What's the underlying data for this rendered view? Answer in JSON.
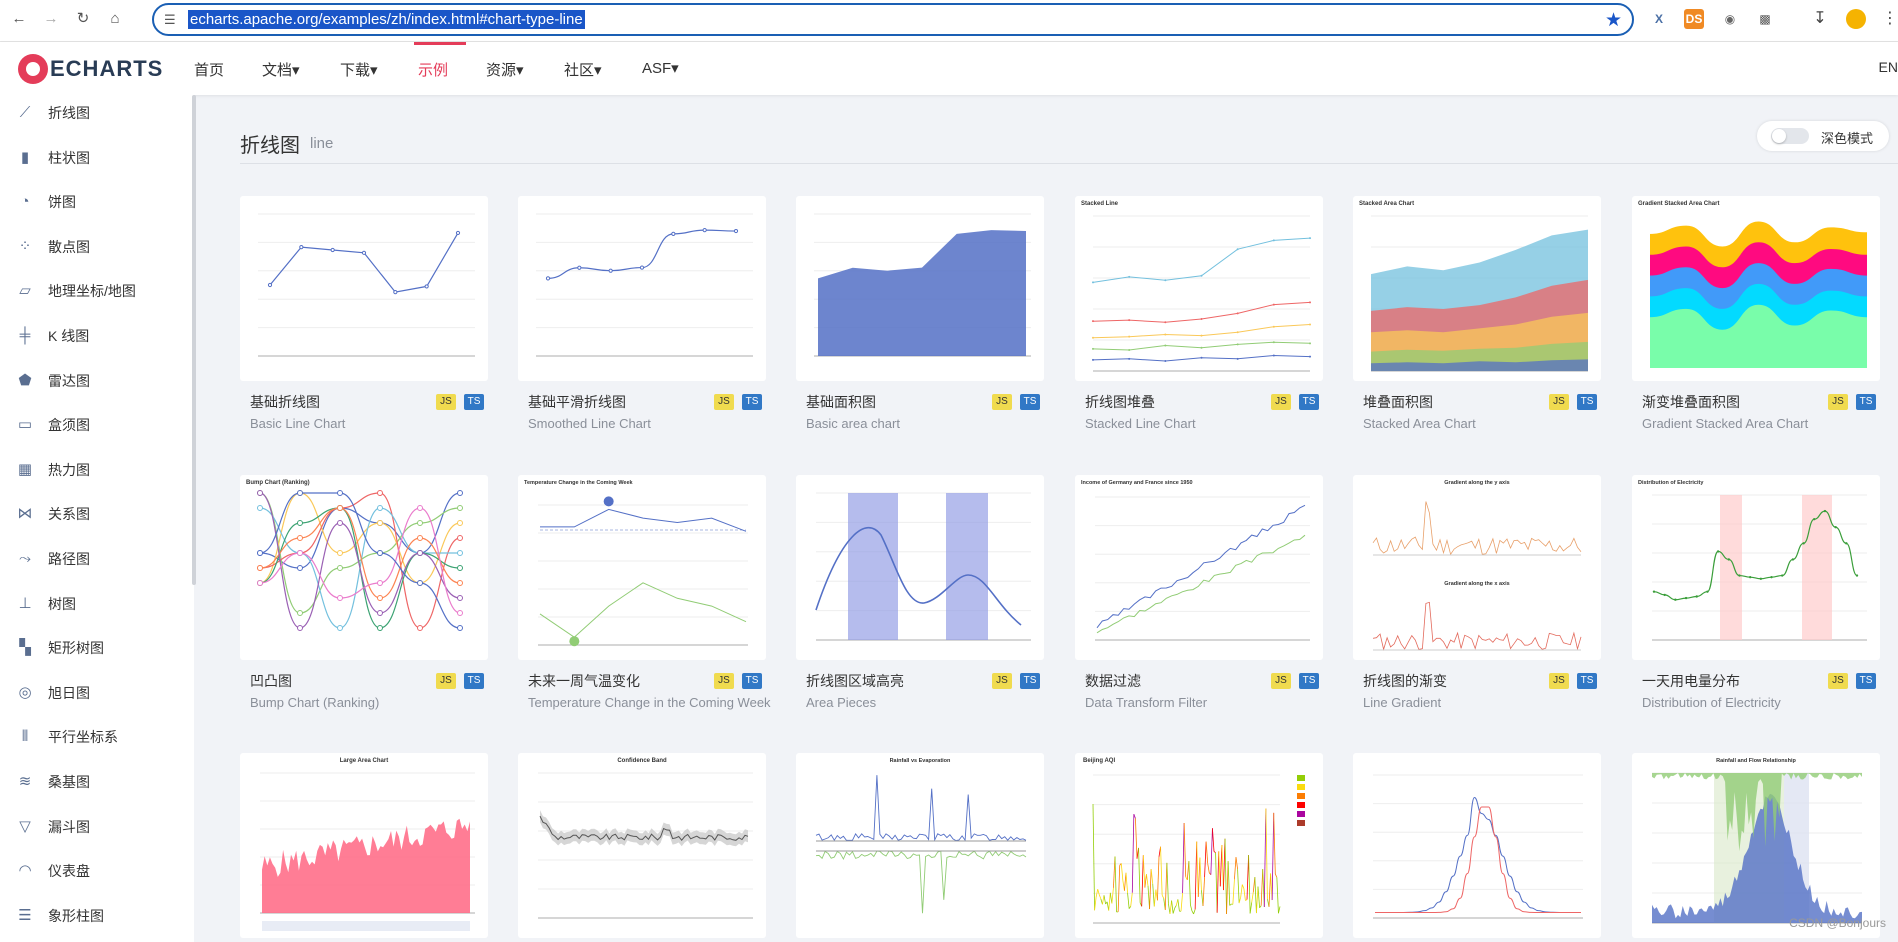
{
  "browser": {
    "url": "echarts.apache.org/examples/zh/index.html#chart-type-line",
    "ext_ds": "DS",
    "ext_x": "X"
  },
  "nav": {
    "logo_text": "ECHARTS",
    "items": [
      {
        "label": "首页"
      },
      {
        "label": "文档▾"
      },
      {
        "label": "下载▾"
      },
      {
        "label": "示例"
      },
      {
        "label": "资源▾"
      },
      {
        "label": "社区▾"
      },
      {
        "label": "ASF▾"
      }
    ],
    "lang": "EN"
  },
  "sidebar": {
    "items": [
      {
        "label": "折线图",
        "icon": "line-chart-icon"
      },
      {
        "label": "柱状图",
        "icon": "bar-chart-icon"
      },
      {
        "label": "饼图",
        "icon": "pie-chart-icon"
      },
      {
        "label": "散点图",
        "icon": "scatter-icon"
      },
      {
        "label": "地理坐标/地图",
        "icon": "map-icon"
      },
      {
        "label": "K 线图",
        "icon": "candlestick-icon"
      },
      {
        "label": "雷达图",
        "icon": "radar-icon"
      },
      {
        "label": "盒须图",
        "icon": "boxplot-icon"
      },
      {
        "label": "热力图",
        "icon": "heatmap-icon"
      },
      {
        "label": "关系图",
        "icon": "graph-icon"
      },
      {
        "label": "路径图",
        "icon": "lines-icon"
      },
      {
        "label": "树图",
        "icon": "tree-icon"
      },
      {
        "label": "矩形树图",
        "icon": "treemap-icon"
      },
      {
        "label": "旭日图",
        "icon": "sunburst-icon"
      },
      {
        "label": "平行坐标系",
        "icon": "parallel-icon"
      },
      {
        "label": "桑基图",
        "icon": "sankey-icon"
      },
      {
        "label": "漏斗图",
        "icon": "funnel-icon"
      },
      {
        "label": "仪表盘",
        "icon": "gauge-icon"
      },
      {
        "label": "象形柱图",
        "icon": "pictorial-bar-icon"
      }
    ]
  },
  "main": {
    "title": "折线图",
    "subtitle": "line",
    "dark_mode_label": "深色模式",
    "badge_js": "JS",
    "badge_ts": "TS"
  },
  "cards": [
    {
      "title": "基础折线图",
      "subtitle": "Basic Line Chart"
    },
    {
      "title": "基础平滑折线图",
      "subtitle": "Smoothed Line Chart"
    },
    {
      "title": "基础面积图",
      "subtitle": "Basic area chart"
    },
    {
      "title": "折线图堆叠",
      "subtitle": "Stacked Line Chart"
    },
    {
      "title": "堆叠面积图",
      "subtitle": "Stacked Area Chart"
    },
    {
      "title": "渐变堆叠面积图",
      "subtitle": "Gradient Stacked Area Chart"
    },
    {
      "title": "凹凸图",
      "subtitle": "Bump Chart (Ranking)"
    },
    {
      "title": "未来一周气温变化",
      "subtitle": "Temperature Change in the Coming Week"
    },
    {
      "title": "折线图区域高亮",
      "subtitle": "Area Pieces"
    },
    {
      "title": "数据过滤",
      "subtitle": "Data Transform Filter"
    },
    {
      "title": "折线图的渐变",
      "subtitle": "Line Gradient"
    },
    {
      "title": "一天用电量分布",
      "subtitle": "Distribution of Electricity"
    },
    {
      "title": "",
      "subtitle": ""
    },
    {
      "title": "",
      "subtitle": ""
    },
    {
      "title": "",
      "subtitle": ""
    },
    {
      "title": "",
      "subtitle": ""
    },
    {
      "title": "",
      "subtitle": ""
    },
    {
      "title": "",
      "subtitle": ""
    }
  ],
  "thumb_titles": {
    "t3": "Stacked Line",
    "t4": "Stacked Area Chart",
    "t5": "Gradient Stacked Area Chart",
    "t6": "Bump Chart (Ranking)",
    "t7": "Temperature Change in the Coming Week",
    "t9": "Income of Germany and France since 1950",
    "t10a": "Gradient along the y axis",
    "t10b": "Gradient along the x axis",
    "t11": "Distribution of Electricity",
    "t12": "Large Area Chart",
    "t13": "Confidence Band",
    "t14": "Rainfall vs Evaporation",
    "t15": "Beijing AQI",
    "t17": "Rainfall and Flow Relationship"
  },
  "watermark": "CSDN @Bonjours",
  "colors": {
    "accent": "#e43c59",
    "chart_blue": "#5470c6",
    "chart_green": "#91cc75"
  }
}
